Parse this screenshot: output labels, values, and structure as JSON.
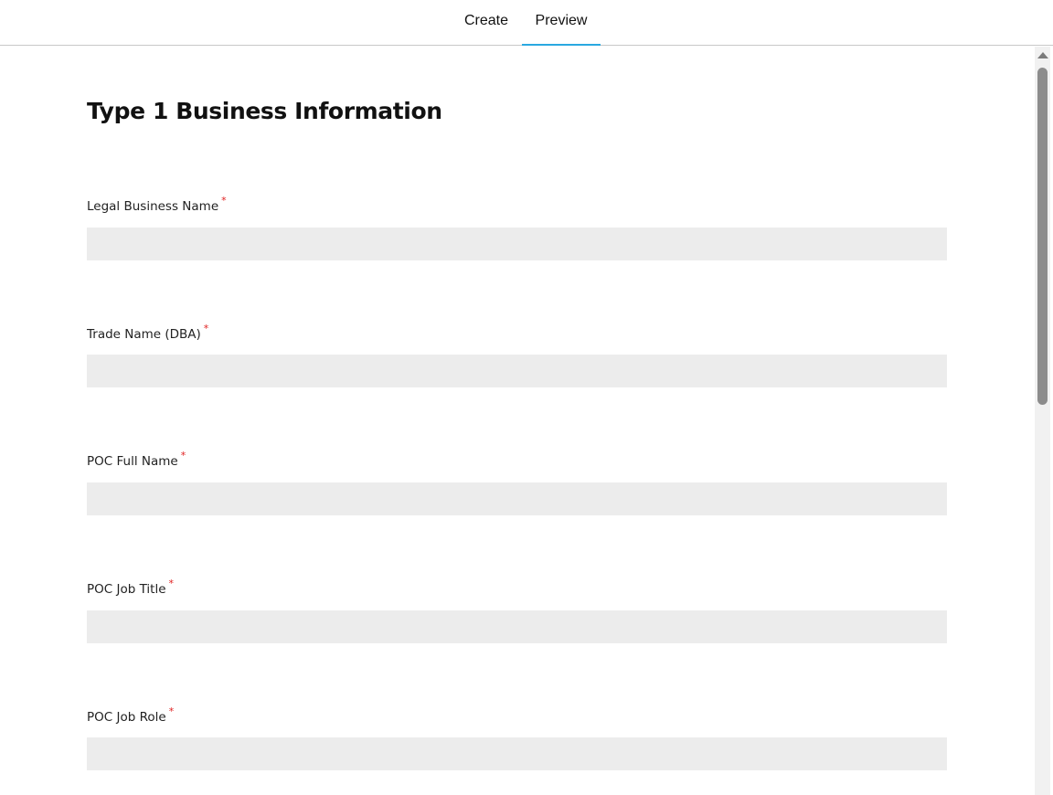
{
  "tabs": {
    "create": "Create",
    "preview": "Preview",
    "active": "preview",
    "accent_color": "#29a8e0"
  },
  "form": {
    "title": "Type 1 Business Information",
    "required_marker": "*",
    "fields": [
      {
        "label": "Legal Business Name",
        "value": "",
        "required": true
      },
      {
        "label": "Trade Name (DBA)",
        "value": "",
        "required": true
      },
      {
        "label": "POC Full Name",
        "value": "",
        "required": true
      },
      {
        "label": "POC Job Title",
        "value": "",
        "required": true
      },
      {
        "label": "POC Job Role",
        "value": "",
        "required": true
      }
    ]
  }
}
